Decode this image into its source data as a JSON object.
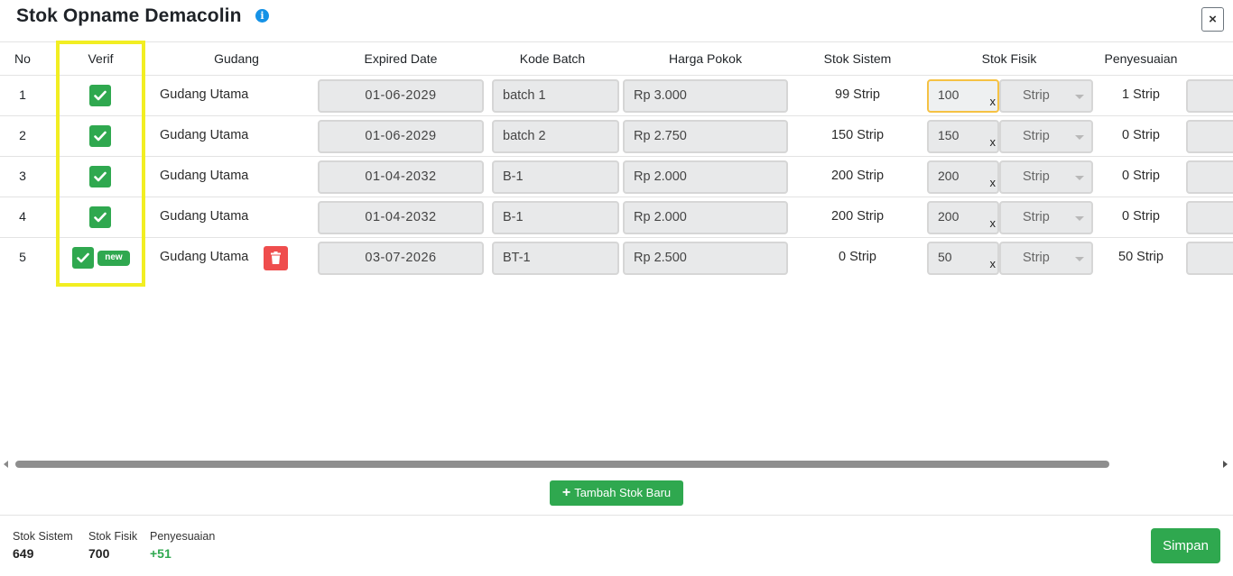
{
  "modal": {
    "title": "Stok Opname Demacolin",
    "info_icon": "i",
    "close_label": "×"
  },
  "table": {
    "headers": {
      "no": "No",
      "verif": "Verif",
      "gudang": "Gudang",
      "expired_date": "Expired Date",
      "kode_batch": "Kode Batch",
      "harga_pokok": "Harga Pokok",
      "stok_sistem": "Stok Sistem",
      "stok_fisik": "Stok Fisik",
      "penyesuaian": "Penyesuaian"
    },
    "rows": [
      {
        "no": "1",
        "verified": true,
        "badge": "",
        "gudang": "Gudang Utama",
        "expired_date": "01-06-2029",
        "kode_batch": "batch 1",
        "harga_pokok": "Rp 3.000",
        "stok_sistem": "99 Strip",
        "stok_fisik": "100",
        "multiplier": "x",
        "unit": "Strip",
        "penyesuaian": "1 Strip"
      },
      {
        "no": "2",
        "verified": true,
        "badge": "",
        "gudang": "Gudang Utama",
        "expired_date": "01-06-2029",
        "kode_batch": "batch 2",
        "harga_pokok": "Rp 2.750",
        "stok_sistem": "150 Strip",
        "stok_fisik": "150",
        "multiplier": "x",
        "unit": "Strip",
        "penyesuaian": "0 Strip"
      },
      {
        "no": "3",
        "verified": true,
        "badge": "",
        "gudang": "Gudang Utama",
        "expired_date": "01-04-2032",
        "kode_batch": "B-1",
        "harga_pokok": "Rp 2.000",
        "stok_sistem": "200 Strip",
        "stok_fisik": "200",
        "multiplier": "x",
        "unit": "Strip",
        "penyesuaian": "0 Strip"
      },
      {
        "no": "4",
        "verified": true,
        "badge": "",
        "gudang": "Gudang Utama",
        "expired_date": "01-04-2032",
        "kode_batch": "B-1",
        "harga_pokok": "Rp 2.000",
        "stok_sistem": "200 Strip",
        "stok_fisik": "200",
        "multiplier": "x",
        "unit": "Strip",
        "penyesuaian": "0 Strip"
      },
      {
        "no": "5",
        "verified": true,
        "badge": "new",
        "gudang": "Gudang Utama",
        "expired_date": "03-07-2026",
        "kode_batch": "BT-1",
        "harga_pokok": "Rp 2.500",
        "stok_sistem": "0 Strip",
        "stok_fisik": "50",
        "multiplier": "x",
        "unit": "Strip",
        "penyesuaian": "50 Strip"
      }
    ]
  },
  "actions": {
    "add_stock_label": "Tambah Stok Baru",
    "save_label": "Simpan"
  },
  "summary": {
    "stok_sistem_label": "Stok Sistem",
    "stok_sistem_value": "649",
    "stok_fisik_label": "Stok Fisik",
    "stok_fisik_value": "700",
    "penyesuaian_label": "Penyesuaian",
    "penyesuaian_value": "+51"
  },
  "colors": {
    "success": "#2fa84f",
    "danger": "#ef4d4d",
    "info": "#1592e6",
    "highlight": "#f2ee22",
    "focus_border": "#f5c244"
  },
  "icons": [
    "info-icon",
    "close-icon",
    "check-icon",
    "trash-icon",
    "plus-icon",
    "caret-down-icon",
    "scroll-left-arrow-icon",
    "scroll-right-arrow-icon"
  ]
}
